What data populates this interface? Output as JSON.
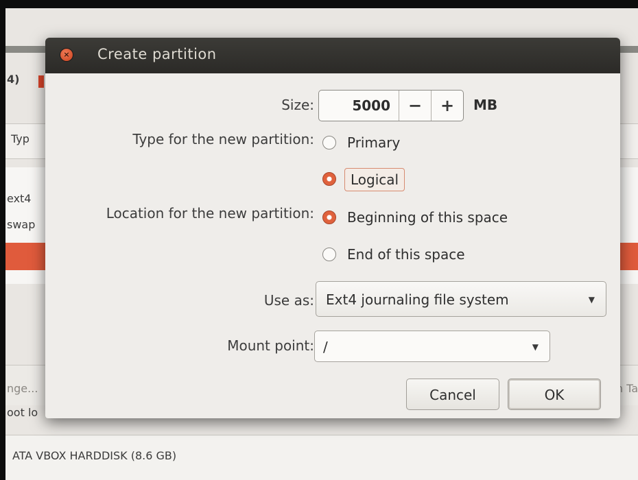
{
  "background": {
    "partial_number": "4)",
    "type_header": "Typ",
    "rows": [
      "ext4",
      "swap"
    ],
    "change_button": "nge...",
    "right_edge": "n Ta",
    "bootloader_label": "oot lo",
    "device": "ATA VBOX HARDDISK (8.6 GB)"
  },
  "dialog": {
    "title": "Create partition",
    "size_label": "Size:",
    "size_value": "5000",
    "minus": "−",
    "plus": "+",
    "size_unit": "MB",
    "type_label": "Type for the new partition:",
    "type_options": [
      "Primary",
      "Logical"
    ],
    "type_selected": "Logical",
    "location_label": "Location for the new partition:",
    "location_options": [
      "Beginning of this space",
      "End of this space"
    ],
    "location_selected": "Beginning of this space",
    "use_as_label": "Use as:",
    "use_as_value": "Ext4 journaling file system",
    "mount_label": "Mount point:",
    "mount_value": "/",
    "cancel_label": "Cancel",
    "ok_label": "OK"
  },
  "colors": {
    "accent": "#e0623d",
    "titlebar": "#2b2a27"
  }
}
